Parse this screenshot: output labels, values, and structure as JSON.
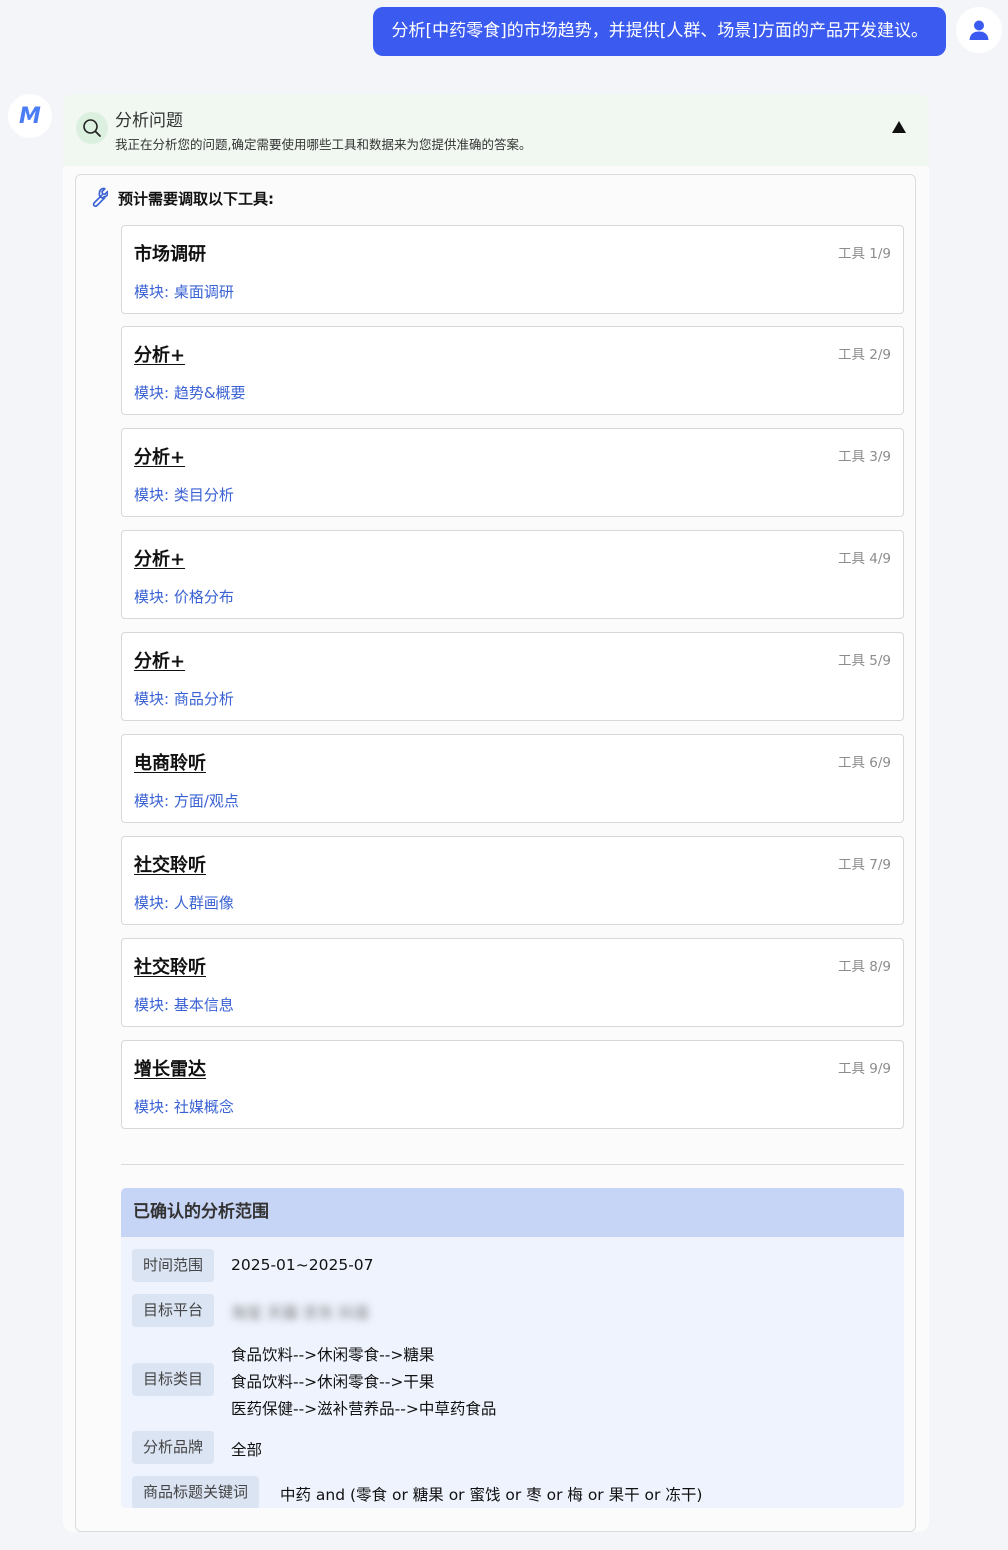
{
  "user_message": "分析[中药零食]的市场趋势，并提供[人群、场景]方面的产品开发建议。",
  "assistant": {
    "avatar_letter": "M",
    "header": {
      "title": "分析问题",
      "subtitle": "我正在分析您的问题,确定需要使用哪些工具和数据来为您提供准确的答案。"
    },
    "tools_label": "预计需要调取以下工具:",
    "tools": [
      {
        "name": "市场调研",
        "module": "模块: 桌面调研",
        "index": "工具 1/9"
      },
      {
        "name": "分析+",
        "module": "模块: 趋势&概要",
        "index": "工具 2/9"
      },
      {
        "name": "分析+",
        "module": "模块: 类目分析",
        "index": "工具 3/9"
      },
      {
        "name": "分析+",
        "module": "模块: 价格分布",
        "index": "工具 4/9"
      },
      {
        "name": "分析+",
        "module": "模块: 商品分析",
        "index": "工具 5/9"
      },
      {
        "name": "电商聆听",
        "module": "模块: 方面/观点",
        "index": "工具 6/9"
      },
      {
        "name": "社交聆听",
        "module": "模块: 人群画像",
        "index": "工具 7/9"
      },
      {
        "name": "社交聆听",
        "module": "模块: 基本信息",
        "index": "工具 8/9"
      },
      {
        "name": "增长雷达",
        "module": "模块: 社媒概念",
        "index": "工具 9/9"
      }
    ],
    "scope": {
      "title": "已确认的分析范围",
      "time_label": "时间范围",
      "time_value": "2025-01~2025-07",
      "platform_label": "目标平台",
      "platform_value": "淘宝 天猫 京东 抖音",
      "category_label": "目标类目",
      "categories": [
        "食品饮料-->休闲零食-->糖果",
        "食品饮料-->休闲零食-->干果",
        "医药保健-->滋补营养品-->中草药食品"
      ],
      "brand_label": "分析品牌",
      "brand_value": "全部",
      "keyword_label": "商品标题关键词",
      "keyword_value": "中药 and (零食 or 糖果 or 蜜饯 or 枣 or 梅 or 果干 or 冻干)"
    }
  },
  "colors": {
    "accent": "#3b5bf0",
    "module_text": "#3a62d4",
    "header_bg": "#f0f8f1",
    "scope_head_bg": "#c6d4f5"
  },
  "icons": [
    "user-icon",
    "search-icon",
    "wrench-icon",
    "collapse-arrow-icon"
  ]
}
